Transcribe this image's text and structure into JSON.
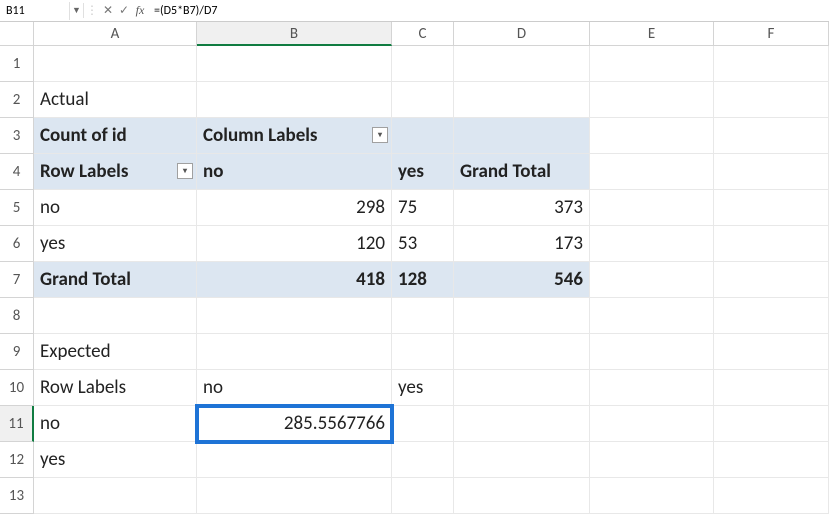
{
  "formula_bar": {
    "name_box": "B11",
    "formula": "=(D5*B7)/D7"
  },
  "columns": [
    "A",
    "B",
    "C",
    "D",
    "E",
    "F"
  ],
  "rows": [
    "1",
    "2",
    "3",
    "4",
    "5",
    "6",
    "7",
    "8",
    "9",
    "10",
    "11",
    "12",
    "13"
  ],
  "cells": {
    "A2": "Actual",
    "A3": "Count of id",
    "B3": "Column Labels",
    "A4": "Row Labels",
    "B4": "no",
    "C4": "yes",
    "D4": "Grand Total",
    "A5": "no",
    "B5": "298",
    "C5": "75",
    "D5": "373",
    "A6": "yes",
    "B6": "120",
    "C6": "53",
    "D6": "173",
    "A7": "Grand Total",
    "B7": "418",
    "C7": "128",
    "D7": "546",
    "A9": "Expected",
    "A10": "Row Labels",
    "B10": "no",
    "C10": "yes",
    "A11": "no",
    "B11": "285.5567766",
    "A12": "yes"
  },
  "active_col": "B",
  "active_row": "11",
  "chart_data": {
    "type": "table",
    "title": "Actual Count of id",
    "row_labels": [
      "no",
      "yes",
      "Grand Total"
    ],
    "column_labels": [
      "no",
      "yes",
      "Grand Total"
    ],
    "values": [
      [
        298,
        75,
        373
      ],
      [
        120,
        53,
        173
      ],
      [
        418,
        128,
        546
      ]
    ],
    "expected": {
      "B11_formula": "=(D5*B7)/D7",
      "B11_value": 285.5567766
    }
  }
}
